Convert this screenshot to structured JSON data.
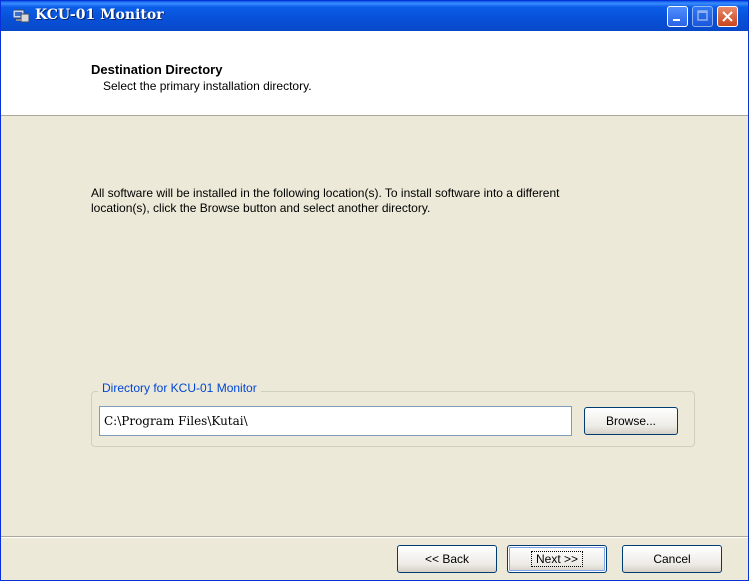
{
  "window": {
    "title": "KCU-01 Monitor"
  },
  "header": {
    "title": "Destination Directory",
    "subtitle": "Select the primary installation directory."
  },
  "intro_text": "All software will be installed in the following location(s). To install software into a different location(s), click the Browse button and select another directory.",
  "directory_group": {
    "label": "Directory for KCU-01 Monitor",
    "path": "C:\\Program Files\\Kutai\\",
    "browse_label": "Browse..."
  },
  "footer": {
    "back_label": "<< Back",
    "next_label": "Next >>",
    "cancel_label": "Cancel"
  },
  "colors": {
    "title_bar": "#0b5ee8",
    "dialog_bg": "#ece9d8",
    "group_label": "#0046d5"
  },
  "icons": [
    "app-icon",
    "minimize-icon",
    "maximize-icon",
    "close-icon"
  ]
}
